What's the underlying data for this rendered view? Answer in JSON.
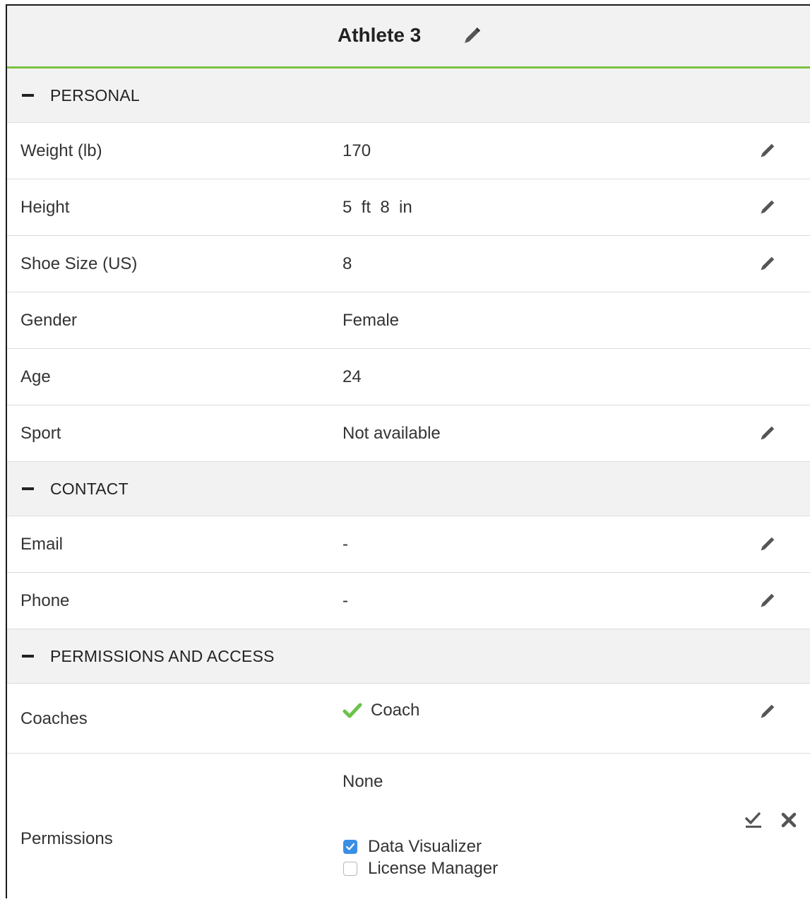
{
  "header": {
    "title": "Athlete 3",
    "edit_icon": "pencil-icon"
  },
  "sections": {
    "personal": {
      "label": "PERSONAL",
      "rows": [
        {
          "label": "Weight (lb)",
          "value": "170",
          "editable": true
        },
        {
          "label": "Height",
          "value": "5  ft  8  in",
          "editable": true
        },
        {
          "label": "Shoe Size (US)",
          "value": "8",
          "editable": true
        },
        {
          "label": "Gender",
          "value": "Female",
          "editable": false
        },
        {
          "label": "Age",
          "value": "24",
          "editable": false
        },
        {
          "label": "Sport",
          "value": "Not available",
          "editable": true
        }
      ]
    },
    "contact": {
      "label": "CONTACT",
      "rows": [
        {
          "label": "Email",
          "value": "-",
          "editable": true
        },
        {
          "label": "Phone",
          "value": "-",
          "editable": true
        }
      ]
    },
    "permissions": {
      "label": "PERMISSIONS AND ACCESS",
      "coaches": {
        "label": "Coaches",
        "value": "Coach"
      },
      "permissions": {
        "label": "Permissions",
        "current": "None",
        "options": [
          {
            "label": "Data Visualizer",
            "checked": true
          },
          {
            "label": "License Manager",
            "checked": false
          }
        ]
      }
    }
  },
  "colors": {
    "accent_green": "#7cc242",
    "checkbox_blue": "#3b8ee6",
    "section_bg": "#f2f2f2"
  }
}
